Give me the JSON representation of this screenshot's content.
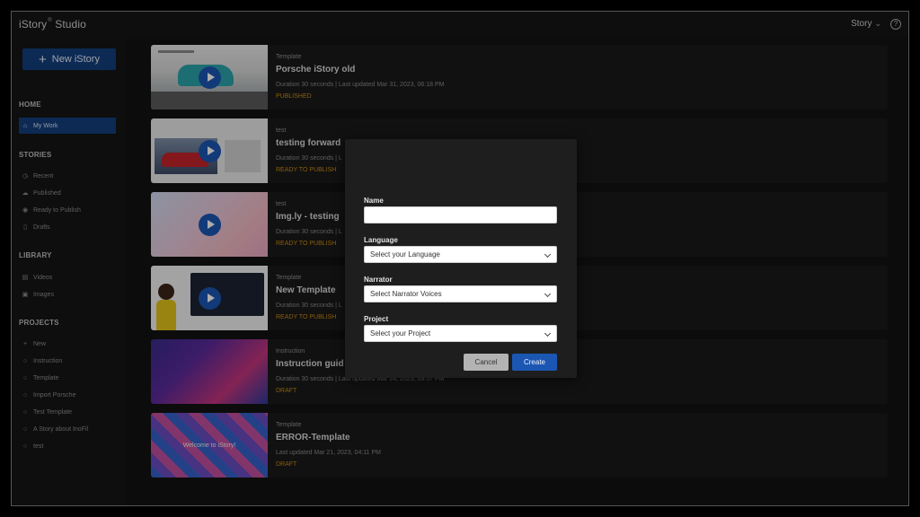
{
  "topbar": {
    "brand": "iStory",
    "brand_sup": "®",
    "brand_suffix": "Studio",
    "account_label": "Story",
    "account_icon": "chevron-down-icon",
    "help_label": "?"
  },
  "sidebar": {
    "new_button": "New iStory",
    "home_title": "HOME",
    "home_items": [
      {
        "label": "My Work",
        "icon": "home-icon"
      }
    ],
    "stories_title": "STORIES",
    "stories_items": [
      {
        "label": "Recent",
        "icon": "clock-icon"
      },
      {
        "label": "Published",
        "icon": "cloud-icon"
      },
      {
        "label": "Ready to Publish",
        "icon": "check-circle-icon"
      },
      {
        "label": "Drafts",
        "icon": "document-icon"
      }
    ],
    "library_title": "LIBRARY",
    "library_items": [
      {
        "label": "Videos",
        "icon": "film-icon"
      },
      {
        "label": "Images",
        "icon": "image-icon"
      }
    ],
    "projects_title": "PROJECTS",
    "projects_items": [
      {
        "label": "New",
        "icon": "plus-icon"
      },
      {
        "label": "Instruction",
        "icon": "circle-icon"
      },
      {
        "label": "Template",
        "icon": "circle-icon"
      },
      {
        "label": "Import Porsche",
        "icon": "circle-icon"
      },
      {
        "label": "Test Template",
        "icon": "circle-icon"
      },
      {
        "label": "A Story about InoFil",
        "icon": "circle-icon"
      },
      {
        "label": "test",
        "icon": "circle-icon"
      }
    ]
  },
  "cards": [
    {
      "category": "Template",
      "title": "Porsche iStory old",
      "meta": "Duration 30 seconds | Last updated Mar 31, 2023, 06:18 PM",
      "status": "PUBLISHED"
    },
    {
      "category": "test",
      "title": "testing forward",
      "meta": "Duration 30 seconds | L",
      "status": "READY TO PUBLISH"
    },
    {
      "category": "test",
      "title": "Img.ly - testing",
      "meta": "Duration 30 seconds | L",
      "status": "READY TO PUBLISH"
    },
    {
      "category": "Template",
      "title": "New Template",
      "meta": "Duration 30 seconds | L",
      "status": "READY TO PUBLISH"
    },
    {
      "category": "Instruction",
      "title": "Instruction guid",
      "meta": "Duration 30 seconds | Last updated Mar 24, 2023, 09:57 PM",
      "status": "DRAFT"
    },
    {
      "category": "Template",
      "title": "ERROR-Template",
      "meta": "Last updated Mar 21, 2023, 04:11 PM",
      "status": "DRAFT",
      "thumb_text": "Welcome to iStory!"
    }
  ],
  "modal": {
    "name_label": "Name",
    "name_value": "",
    "language_label": "Language",
    "language_value": "Select your Language",
    "narrator_label": "Narrator",
    "narrator_value": "Select Narrator Voices",
    "project_label": "Project",
    "project_value": "Select your Project",
    "cancel_label": "Cancel",
    "create_label": "Create"
  },
  "colors": {
    "accent": "#1b56b3",
    "status": "#c98a14",
    "background": "#131313"
  }
}
